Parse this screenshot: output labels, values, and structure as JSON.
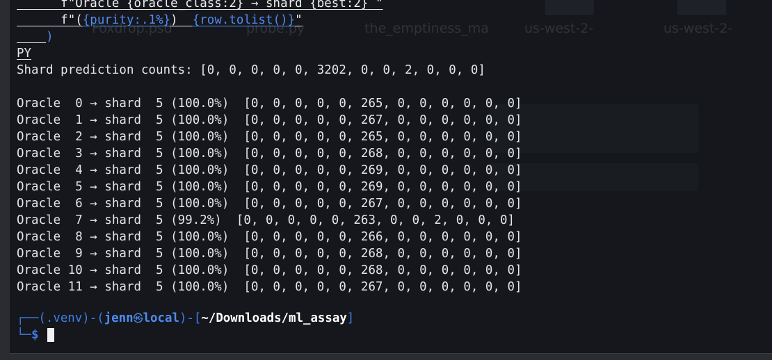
{
  "code_tail": {
    "line1_part1": "      f\"Oracle {oracle_class:2} → shard {best:2} \"",
    "line2_prefix": "      f\"(",
    "line2_fmt": "{purity:.1%}",
    "line2_mid": ")  ",
    "line2_row": "{row.tolist()}",
    "line2_end": "\"",
    "line3_indent": "    ",
    "line3_paren": ")",
    "heredoc_end": "PY"
  },
  "background_ghost": {
    "tabs": [
      "Foxdrop.psd",
      "probe.py",
      "the_emptiness_ma",
      "us-west-2-",
      "us-west-2-"
    ],
    "info": "(Ghost of a window behind, mostly transparent)"
  },
  "output": {
    "summary": "Shard prediction counts: [0, 0, 0, 0, 0, 3202, 0, 0, 2, 0, 0, 0]",
    "rows": [
      "Oracle  0 → shard  5 (100.0%)  [0, 0, 0, 0, 0, 265, 0, 0, 0, 0, 0, 0]",
      "Oracle  1 → shard  5 (100.0%)  [0, 0, 0, 0, 0, 267, 0, 0, 0, 0, 0, 0]",
      "Oracle  2 → shard  5 (100.0%)  [0, 0, 0, 0, 0, 265, 0, 0, 0, 0, 0, 0]",
      "Oracle  3 → shard  5 (100.0%)  [0, 0, 0, 0, 0, 268, 0, 0, 0, 0, 0, 0]",
      "Oracle  4 → shard  5 (100.0%)  [0, 0, 0, 0, 0, 269, 0, 0, 0, 0, 0, 0]",
      "Oracle  5 → shard  5 (100.0%)  [0, 0, 0, 0, 0, 269, 0, 0, 0, 0, 0, 0]",
      "Oracle  6 → shard  5 (100.0%)  [0, 0, 0, 0, 0, 267, 0, 0, 0, 0, 0, 0]",
      "Oracle  7 → shard  5 (99.2%)  [0, 0, 0, 0, 0, 263, 0, 0, 2, 0, 0, 0]",
      "Oracle  8 → shard  5 (100.0%)  [0, 0, 0, 0, 0, 266, 0, 0, 0, 0, 0, 0]",
      "Oracle  9 → shard  5 (100.0%)  [0, 0, 0, 0, 0, 268, 0, 0, 0, 0, 0, 0]",
      "Oracle 10 → shard  5 (100.0%)  [0, 0, 0, 0, 0, 268, 0, 0, 0, 0, 0, 0]",
      "Oracle 11 → shard  5 (100.0%)  [0, 0, 0, 0, 0, 267, 0, 0, 0, 0, 0, 0]"
    ]
  },
  "prompt": {
    "corner_top": "┌──",
    "venv": "(.venv)",
    "dash": "-",
    "open_paren": "(",
    "user": "jenn",
    "at_symbol": "㉿",
    "host": "local",
    "close_paren": ")",
    "dash2": "-",
    "open_bracket": "[",
    "path": "~/Downloads/ml_assay",
    "close_bracket": "]",
    "corner_bottom": "└─",
    "dollar": "$"
  },
  "colors": {
    "terminal_bg": "#15171c",
    "prompt_accent": "#3d7de6",
    "user_host": "#4f8cf2",
    "text": "#e4e6ea"
  }
}
